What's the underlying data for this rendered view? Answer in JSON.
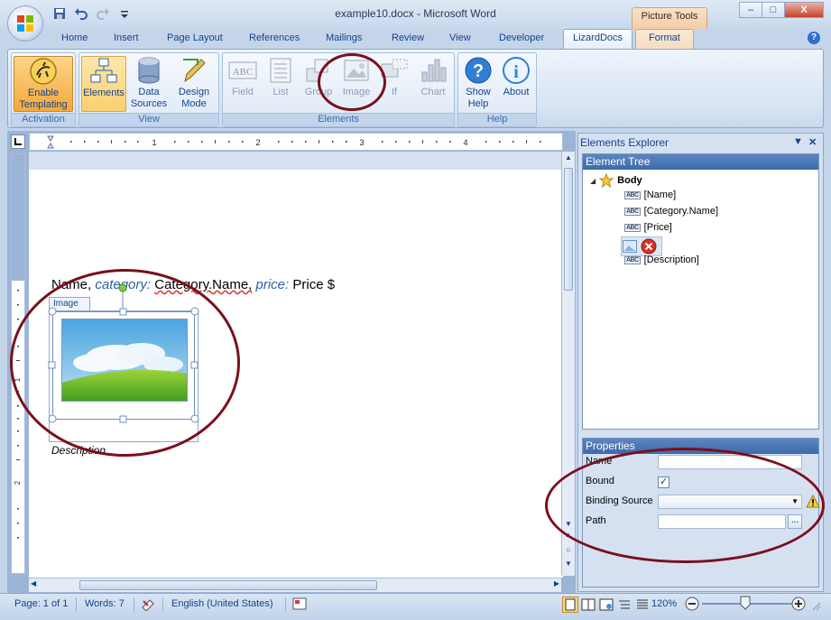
{
  "window": {
    "title": "example10.docx - Microsoft Word",
    "contextual_tab_group": "Picture Tools",
    "minimize": "–",
    "maximize": "□",
    "close": "X"
  },
  "tabs": [
    {
      "label": "Home"
    },
    {
      "label": "Insert"
    },
    {
      "label": "Page Layout"
    },
    {
      "label": "References"
    },
    {
      "label": "Mailings"
    },
    {
      "label": "Review"
    },
    {
      "label": "View"
    },
    {
      "label": "Developer"
    },
    {
      "label": "LizardDocs",
      "active": true
    },
    {
      "label": "Format"
    }
  ],
  "ribbon": {
    "groups": [
      {
        "label": "Activation",
        "buttons": [
          {
            "label1": "Enable",
            "label2": "Templating",
            "icon": "lizard-icon",
            "state": "hot"
          }
        ]
      },
      {
        "label": "View",
        "buttons": [
          {
            "label1": "Elements",
            "label2": "",
            "icon": "elements-tree-icon",
            "state": "pressed"
          },
          {
            "label1": "Data",
            "label2": "Sources",
            "icon": "database-icon"
          },
          {
            "label1": "Design",
            "label2": "Mode",
            "icon": "design-mode-icon"
          }
        ]
      },
      {
        "label": "Elements",
        "buttons": [
          {
            "label1": "Field",
            "icon": "field-icon",
            "state": "disabled"
          },
          {
            "label1": "List",
            "icon": "list-icon",
            "state": "disabled"
          },
          {
            "label1": "Group",
            "icon": "group-icon",
            "state": "disabled"
          },
          {
            "label1": "Image",
            "icon": "image-icon",
            "state": "disabled"
          },
          {
            "label1": "If",
            "icon": "if-icon",
            "state": "disabled"
          },
          {
            "label1": "Chart",
            "icon": "chart-icon",
            "state": "disabled"
          }
        ]
      },
      {
        "label": "Help",
        "buttons": [
          {
            "label1": "Show",
            "label2": "Help",
            "icon": "help-icon"
          },
          {
            "label1": "About",
            "label2": "",
            "icon": "about-icon"
          }
        ]
      }
    ]
  },
  "ruler_numbers": [
    "1",
    "2",
    "3",
    "4"
  ],
  "vruler_numbers": [
    "1",
    "2"
  ],
  "document": {
    "line": {
      "name": "Name,",
      "category_label": "category:",
      "category_value": "Category.Name,",
      "price_label": "price:",
      "price_value": "Price $"
    },
    "image_control_tag": "Image",
    "description": "Description"
  },
  "explorer": {
    "title": "Elements Explorer",
    "tree_header": "Element Tree",
    "root": "Body",
    "nodes": [
      "[Name]",
      "[Category.Name]",
      "[Price]",
      "",
      "[Description]"
    ],
    "properties_header": "Properties",
    "properties": {
      "name_label": "Name",
      "name_value": "",
      "bound_label": "Bound",
      "bound_checked": true,
      "binding_source_label": "Binding Source",
      "binding_source_value": "",
      "path_label": "Path",
      "path_value": "",
      "browse": "..."
    }
  },
  "status": {
    "page": "Page: 1 of 1",
    "words": "Words: 7",
    "language": "English (United States)",
    "zoom": "120%"
  },
  "colors": {
    "annotation": "#7b0f1c",
    "ribbon_active": "#fbcf6e",
    "pane_header": "#3d6aa9"
  }
}
